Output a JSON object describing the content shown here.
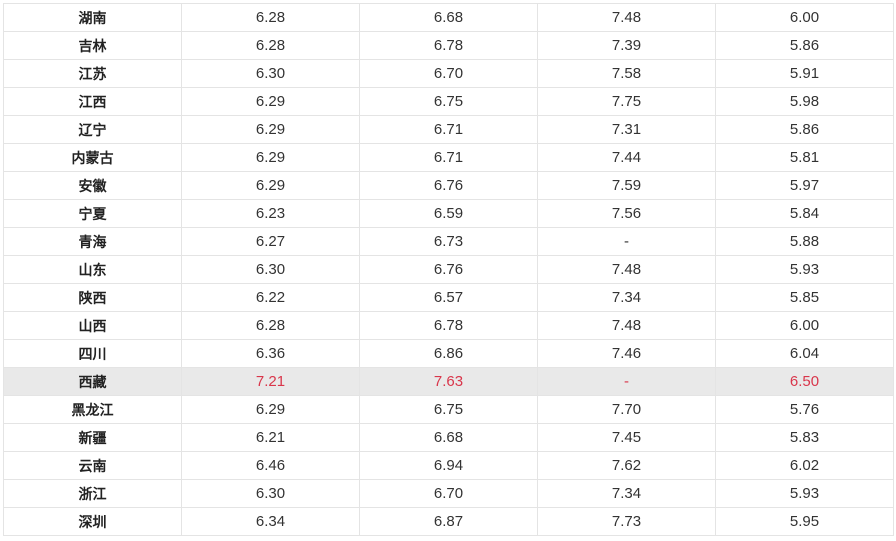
{
  "table": {
    "rows": [
      {
        "region": "湖南",
        "v1": "6.28",
        "v2": "6.68",
        "v3": "7.48",
        "v4": "6.00",
        "highlight": false
      },
      {
        "region": "吉林",
        "v1": "6.28",
        "v2": "6.78",
        "v3": "7.39",
        "v4": "5.86",
        "highlight": false
      },
      {
        "region": "江苏",
        "v1": "6.30",
        "v2": "6.70",
        "v3": "7.58",
        "v4": "5.91",
        "highlight": false
      },
      {
        "region": "江西",
        "v1": "6.29",
        "v2": "6.75",
        "v3": "7.75",
        "v4": "5.98",
        "highlight": false
      },
      {
        "region": "辽宁",
        "v1": "6.29",
        "v2": "6.71",
        "v3": "7.31",
        "v4": "5.86",
        "highlight": false
      },
      {
        "region": "内蒙古",
        "v1": "6.29",
        "v2": "6.71",
        "v3": "7.44",
        "v4": "5.81",
        "highlight": false
      },
      {
        "region": "安徽",
        "v1": "6.29",
        "v2": "6.76",
        "v3": "7.59",
        "v4": "5.97",
        "highlight": false
      },
      {
        "region": "宁夏",
        "v1": "6.23",
        "v2": "6.59",
        "v3": "7.56",
        "v4": "5.84",
        "highlight": false
      },
      {
        "region": "青海",
        "v1": "6.27",
        "v2": "6.73",
        "v3": "-",
        "v4": "5.88",
        "highlight": false
      },
      {
        "region": "山东",
        "v1": "6.30",
        "v2": "6.76",
        "v3": "7.48",
        "v4": "5.93",
        "highlight": false
      },
      {
        "region": "陕西",
        "v1": "6.22",
        "v2": "6.57",
        "v3": "7.34",
        "v4": "5.85",
        "highlight": false
      },
      {
        "region": "山西",
        "v1": "6.28",
        "v2": "6.78",
        "v3": "7.48",
        "v4": "6.00",
        "highlight": false
      },
      {
        "region": "四川",
        "v1": "6.36",
        "v2": "6.86",
        "v3": "7.46",
        "v4": "6.04",
        "highlight": false
      },
      {
        "region": "西藏",
        "v1": "7.21",
        "v2": "7.63",
        "v3": "-",
        "v4": "6.50",
        "highlight": true
      },
      {
        "region": "黑龙江",
        "v1": "6.29",
        "v2": "6.75",
        "v3": "7.70",
        "v4": "5.76",
        "highlight": false
      },
      {
        "region": "新疆",
        "v1": "6.21",
        "v2": "6.68",
        "v3": "7.45",
        "v4": "5.83",
        "highlight": false
      },
      {
        "region": "云南",
        "v1": "6.46",
        "v2": "6.94",
        "v3": "7.62",
        "v4": "6.02",
        "highlight": false
      },
      {
        "region": "浙江",
        "v1": "6.30",
        "v2": "6.70",
        "v3": "7.34",
        "v4": "5.93",
        "highlight": false
      },
      {
        "region": "深圳",
        "v1": "6.34",
        "v2": "6.87",
        "v3": "7.73",
        "v4": "5.95",
        "highlight": false
      }
    ]
  },
  "colors": {
    "highlight_row_bg": "#e9e9e9",
    "highlight_text": "#d9364b",
    "border": "#e4e4e4",
    "text": "#333333"
  }
}
